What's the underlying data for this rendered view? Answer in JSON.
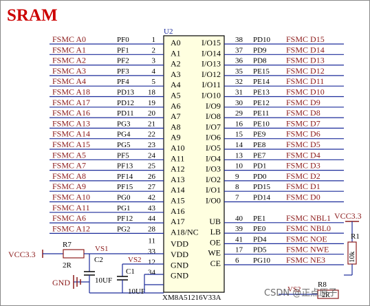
{
  "title": "SRAM",
  "chip": {
    "ref": "U2",
    "part": "XM8A51216V33A",
    "left_pins": [
      {
        "name": "A0",
        "num": "1",
        "port": "PF0",
        "net": "FSMC_A0"
      },
      {
        "name": "A1",
        "num": "2",
        "port": "PF1",
        "net": "FSMC_A1"
      },
      {
        "name": "A2",
        "num": "3",
        "port": "PF2",
        "net": "FSMC_A2"
      },
      {
        "name": "A3",
        "num": "4",
        "port": "PF3",
        "net": "FSMC_A3"
      },
      {
        "name": "A4",
        "num": "5",
        "port": "PF4",
        "net": "FSMC_A4"
      },
      {
        "name": "A5",
        "num": "18",
        "port": "PD13",
        "net": "FSMC_A18"
      },
      {
        "name": "A6",
        "num": "19",
        "port": "PD12",
        "net": "FSMC_A17"
      },
      {
        "name": "A7",
        "num": "20",
        "port": "PD11",
        "net": "FSMC_A16"
      },
      {
        "name": "A8",
        "num": "21",
        "port": "PG3",
        "net": "FSMC_A13"
      },
      {
        "name": "A9",
        "num": "22",
        "port": "PG4",
        "net": "FSMC_A14"
      },
      {
        "name": "A10",
        "num": "23",
        "port": "PG5",
        "net": "FSMC_A15"
      },
      {
        "name": "A11",
        "num": "24",
        "port": "PF5",
        "net": "FSMC_A5"
      },
      {
        "name": "A12",
        "num": "25",
        "port": "PF13",
        "net": "FSMC_A7"
      },
      {
        "name": "A13",
        "num": "26",
        "port": "PF14",
        "net": "FSMC_A8"
      },
      {
        "name": "A14",
        "num": "27",
        "port": "PF15",
        "net": "FSMC_A9"
      },
      {
        "name": "A15",
        "num": "42",
        "port": "PG0",
        "net": "FSMC_A10"
      },
      {
        "name": "A16",
        "num": "43",
        "port": "PG1",
        "net": "FSMC_A11"
      },
      {
        "name": "A17",
        "num": "44",
        "port": "PF12",
        "net": "FSMC_A6"
      },
      {
        "name": "A18/NC",
        "num": "28",
        "port": "PG2",
        "net": "FSMC_A12"
      },
      {
        "name": "VDD",
        "num": "11",
        "port": "",
        "net": ""
      },
      {
        "name": "VDD",
        "num": "33",
        "port": "",
        "net": ""
      },
      {
        "name": "GND",
        "num": "12",
        "port": "",
        "net": ""
      },
      {
        "name": "GND",
        "num": "34",
        "port": "",
        "net": ""
      }
    ],
    "right_pins": [
      {
        "name": "I/O15",
        "num": "38",
        "port": "PD10",
        "net": "FSMC_D15"
      },
      {
        "name": "I/O14",
        "num": "37",
        "port": "PD9",
        "net": "FSMC_D14"
      },
      {
        "name": "I/O13",
        "num": "36",
        "port": "PD8",
        "net": "FSMC_D13"
      },
      {
        "name": "I/O12",
        "num": "35",
        "port": "PE15",
        "net": "FSMC_D12"
      },
      {
        "name": "I/O11",
        "num": "32",
        "port": "PE14",
        "net": "FSMC_D11"
      },
      {
        "name": "I/O10",
        "num": "31",
        "port": "PE13",
        "net": "FSMC_D10"
      },
      {
        "name": "I/O9",
        "num": "30",
        "port": "PE12",
        "net": "FSMC_D9"
      },
      {
        "name": "I/O8",
        "num": "29",
        "port": "PE11",
        "net": "FSMC_D8"
      },
      {
        "name": "I/O7",
        "num": "16",
        "port": "PE10",
        "net": "FSMC_D7"
      },
      {
        "name": "I/O6",
        "num": "15",
        "port": "PE9",
        "net": "FSMC_D6"
      },
      {
        "name": "I/O5",
        "num": "14",
        "port": "PE8",
        "net": "FSMC_D5"
      },
      {
        "name": "I/O4",
        "num": "13",
        "port": "PE7",
        "net": "FSMC_D4"
      },
      {
        "name": "I/O3",
        "num": "10",
        "port": "PD1",
        "net": "FSMC_D3"
      },
      {
        "name": "I/O2",
        "num": "9",
        "port": "PD0",
        "net": "FSMC_D2"
      },
      {
        "name": "I/O1",
        "num": "8",
        "port": "PD15",
        "net": "FSMC_D1"
      },
      {
        "name": "I/O0",
        "num": "7",
        "port": "PD14",
        "net": "FSMC_D0"
      },
      {
        "name": "UB",
        "num": "40",
        "port": "PE1",
        "net": "FSMC_NBL1"
      },
      {
        "name": "LB",
        "num": "39",
        "port": "PE0",
        "net": "FSMC_NBL0"
      },
      {
        "name": "OE",
        "num": "41",
        "port": "PD4",
        "net": "FSMC_NOE"
      },
      {
        "name": "WE",
        "num": "17",
        "port": "PD5",
        "net": "FSMC_NWE"
      },
      {
        "name": "CE",
        "num": "6",
        "port": "PG10",
        "net": "FSMC_NE3"
      }
    ]
  },
  "parts": {
    "r7_ref": "R7",
    "r7_val": "2R",
    "vs1": "VS1",
    "vs2_a": "VS2",
    "vs2_b": "VS2",
    "c2_ref": "C2",
    "c2_val": "10UF",
    "c1_ref": "C1",
    "c1_val": "10UF",
    "vcc_left": "VCC3.3",
    "vcc_right": "VCC3.3",
    "gnd": "GND",
    "r1_ref": "R1",
    "r1_val": "10k",
    "r8_ref": "R8",
    "r8_val": "2R"
  },
  "watermark": "CSDN @正点原子",
  "colors": {
    "net_label": "#8b1a1a",
    "wire": "#1a2a9a",
    "chip_fill": "#ffffe0",
    "title": "#cc0000"
  }
}
